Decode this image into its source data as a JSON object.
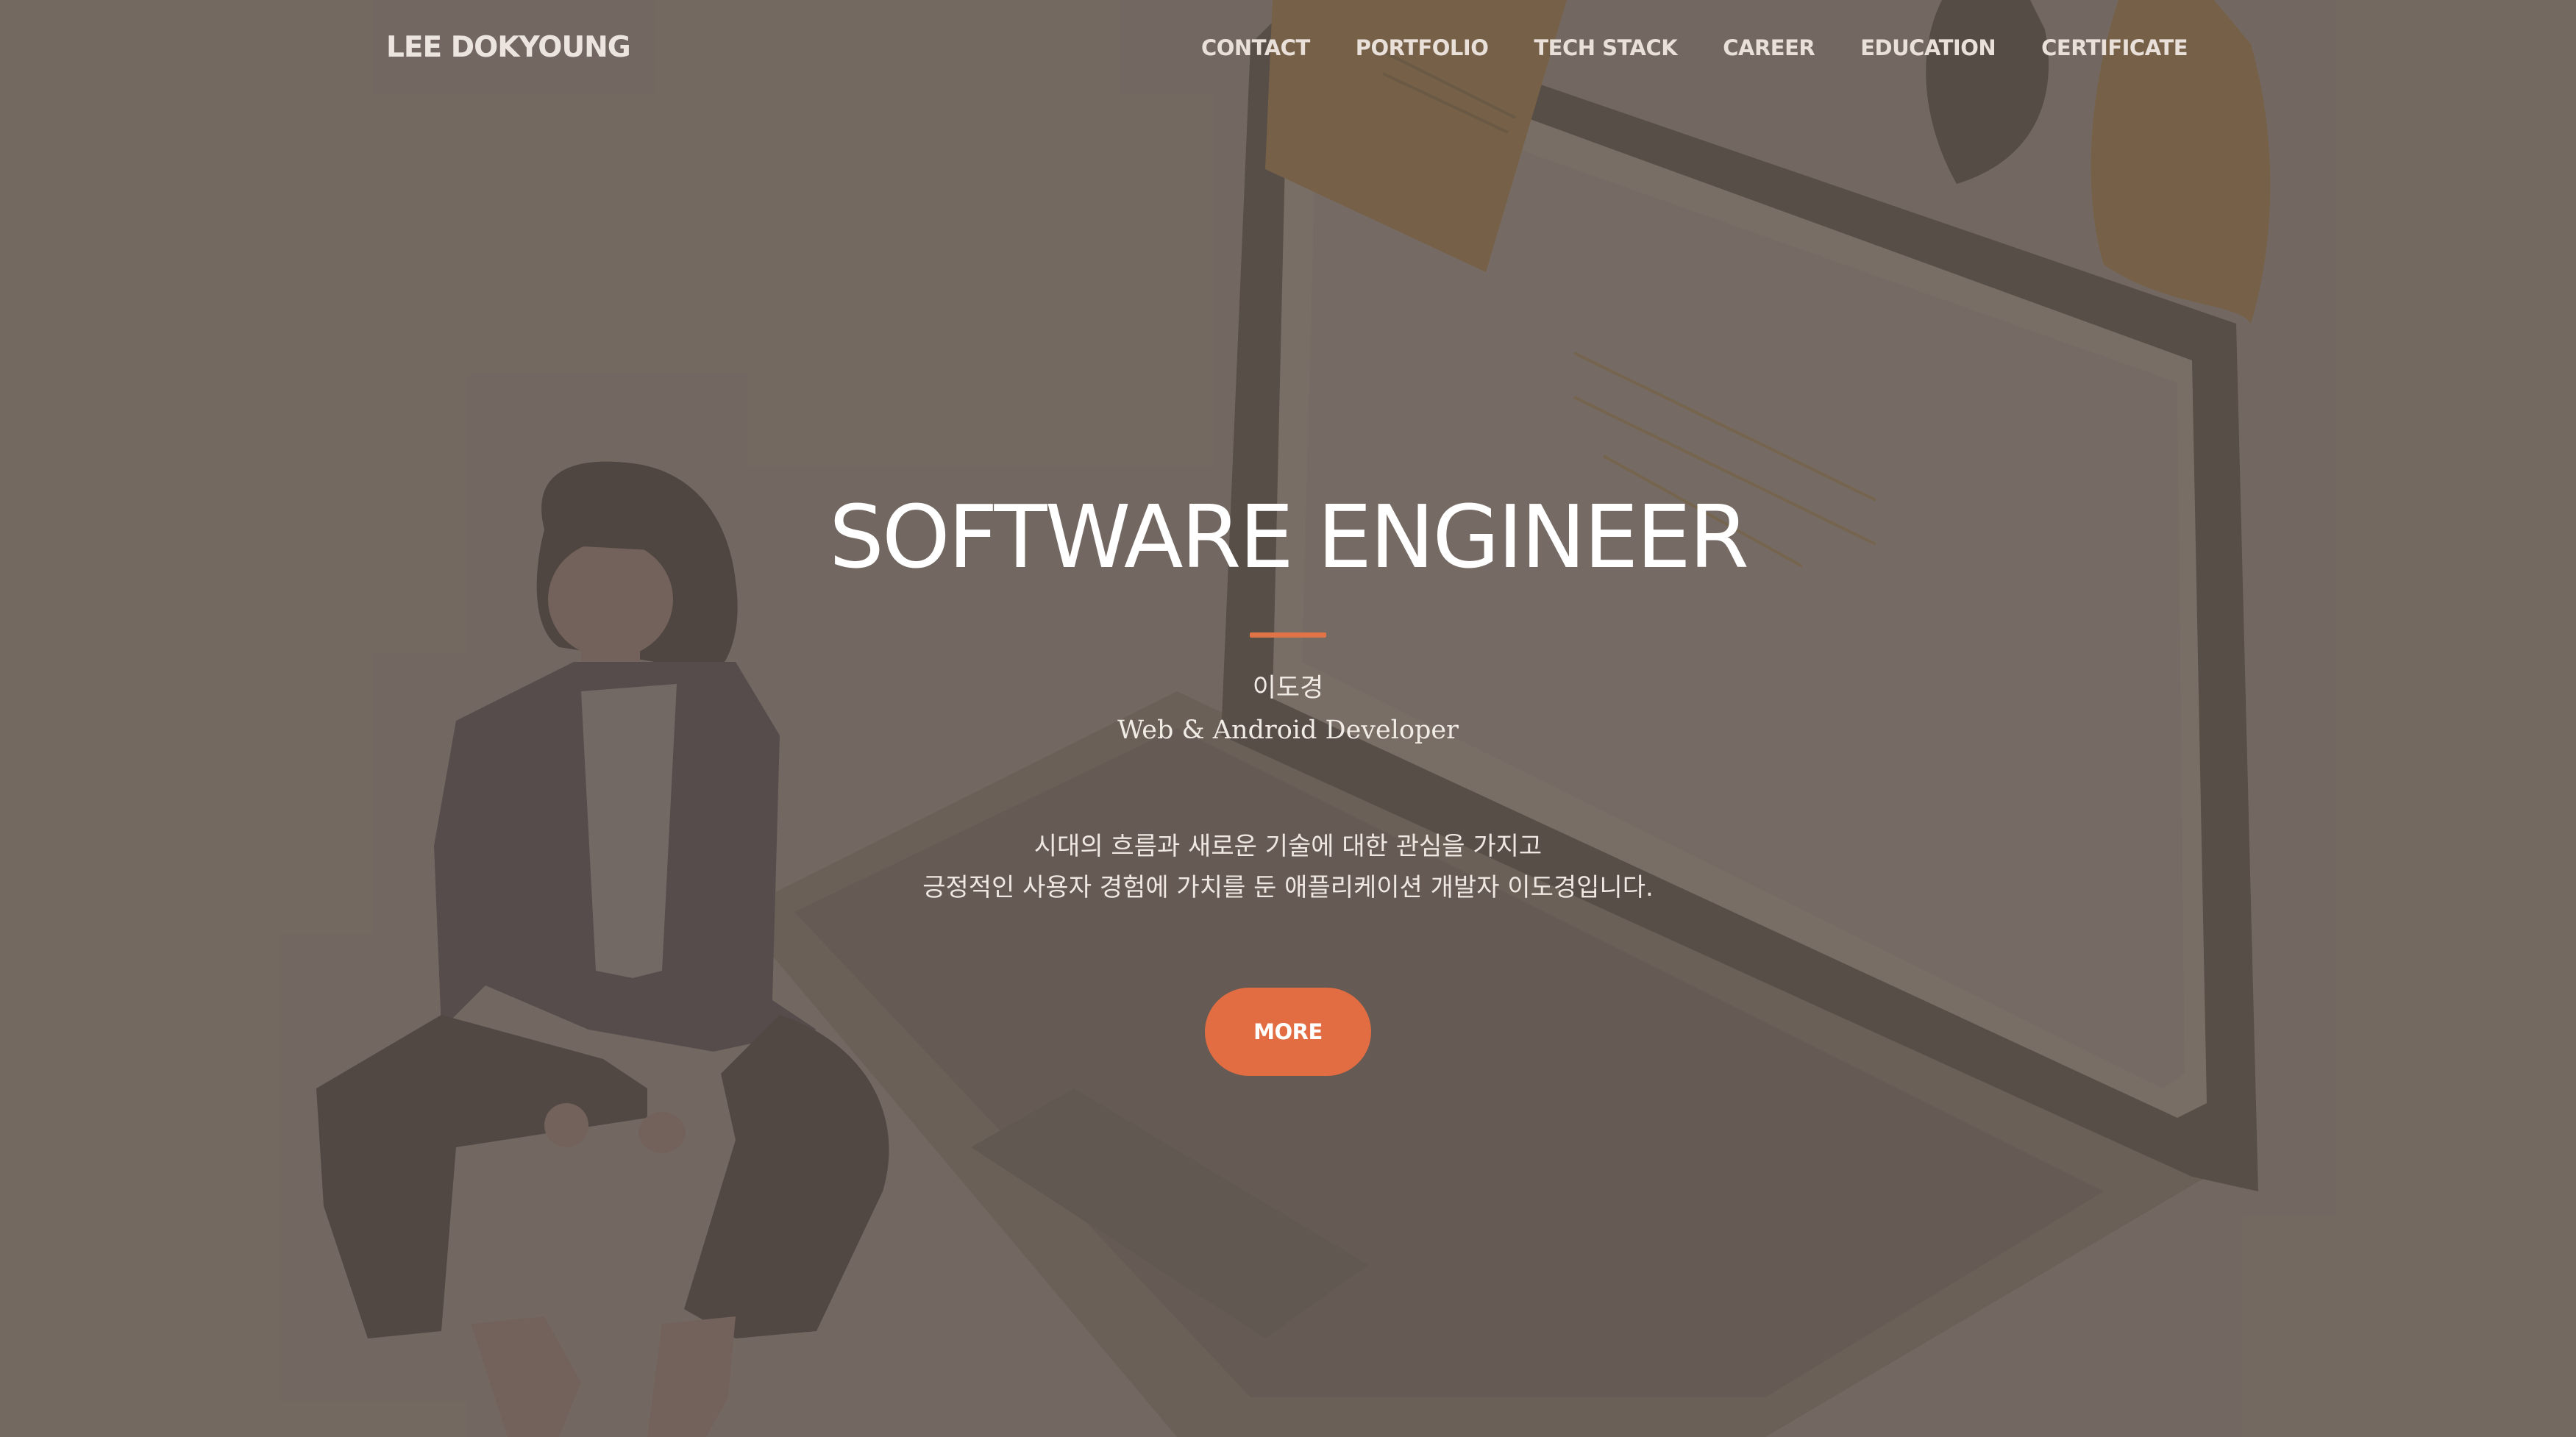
{
  "nav": {
    "brand": "LEE DOKYOUNG",
    "items": [
      {
        "label": "CONTACT"
      },
      {
        "label": "PORTFOLIO"
      },
      {
        "label": "TECH STACK"
      },
      {
        "label": "CAREER"
      },
      {
        "label": "EDUCATION"
      },
      {
        "label": "CERTIFICATE"
      }
    ]
  },
  "hero": {
    "title": "SOFTWARE ENGINEER",
    "name": "이도경",
    "role": "Web & Android Developer",
    "description": [
      "시대의 흐름과 새로운 기술에 대한 관심을 가지고",
      "긍정적인 사용자 경험에 가치를 둔 애플리케이션 개발자 이도경입니다."
    ],
    "button_label": "MORE"
  },
  "colors": {
    "accent": "#e26d43",
    "background": "#7a7068",
    "text": "#ffffff"
  },
  "icons": {
    "background_art": "person-sitting-on-laptop-illustration"
  }
}
